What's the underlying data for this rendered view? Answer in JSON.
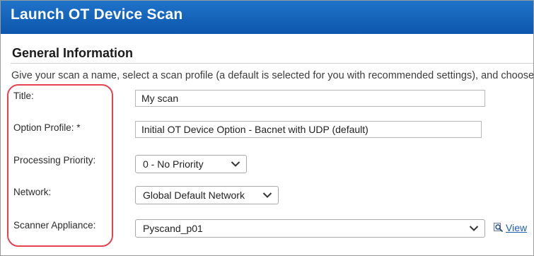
{
  "dialog": {
    "title": "Launch OT Device Scan"
  },
  "general_information": {
    "heading": "General Information",
    "intro": "Give your scan a name, select a scan profile (a default is selected for you with recommended settings), and choose"
  },
  "form": {
    "title": {
      "label": "Title:",
      "value": "My scan"
    },
    "option_profile": {
      "label": "Option Profile: *",
      "value": "Initial OT Device Option - Bacnet with UDP (default)"
    },
    "processing_priority": {
      "label": "Processing Priority:",
      "selected": "0 - No Priority"
    },
    "network": {
      "label": "Network:",
      "selected": "Global Default Network"
    },
    "scanner_appliance": {
      "label": "Scanner Appliance:",
      "selected": "Pyscand_p01",
      "view_link": "View"
    }
  },
  "icons": {
    "dropdown": "chevron-down-icon",
    "view": "magnifier-icon"
  },
  "colors": {
    "titlebar": "#1466bf",
    "highlight": "#e8414f",
    "link": "#1b5fb3"
  }
}
